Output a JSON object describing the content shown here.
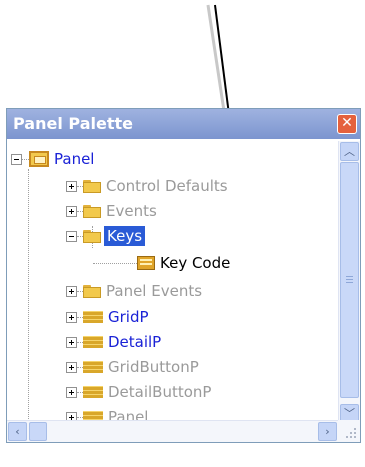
{
  "window": {
    "title": "Panel Palette"
  },
  "titlebar": {
    "close_icon": "close-icon"
  },
  "tree": {
    "root": {
      "label": "Panel",
      "icon": "panel-icon",
      "color": "#1a22d6"
    },
    "items": [
      {
        "label": "Control Defaults",
        "icon": "folder-icon",
        "expander": "plus"
      },
      {
        "label": "Events",
        "icon": "folder-icon",
        "expander": "plus"
      },
      {
        "label": "Keys",
        "icon": "folder-icon",
        "expander": "minus",
        "selected": true
      },
      {
        "label": "Key Code",
        "icon": "keycode-icon"
      },
      {
        "label": "Panel Events",
        "icon": "folder-icon",
        "expander": "plus"
      },
      {
        "label": "GridP",
        "icon": "grid-icon",
        "expander": "plus"
      },
      {
        "label": "DetailP",
        "icon": "grid-icon",
        "expander": "plus"
      },
      {
        "label": "GridButtonP",
        "icon": "grid-icon",
        "expander": "plus"
      },
      {
        "label": "DetailButtonP",
        "icon": "grid-icon",
        "expander": "plus"
      },
      {
        "label": "Panel",
        "icon": "grid-icon",
        "expander": "plus"
      }
    ]
  },
  "colors": {
    "selection": "#2a5bd6",
    "link_blue": "#1a22d6",
    "disabled_gray": "#9a9a9a",
    "title_bar": "#7c95cf"
  }
}
